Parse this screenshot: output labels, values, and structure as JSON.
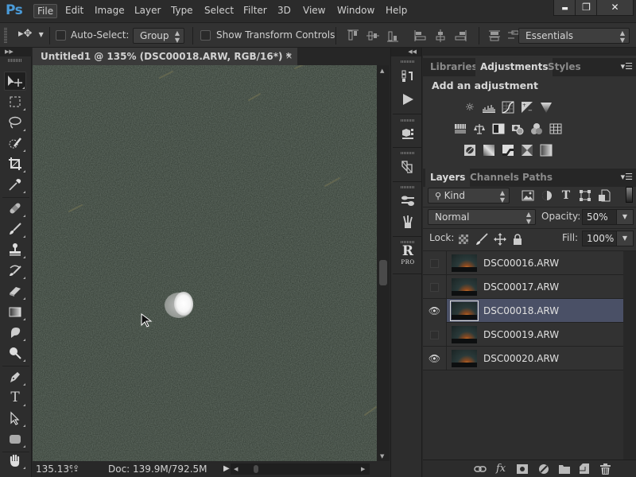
{
  "app": {
    "logo": "Ps"
  },
  "menu": [
    "File",
    "Edit",
    "Image",
    "Layer",
    "Type",
    "Select",
    "Filter",
    "3D",
    "View",
    "Window",
    "Help"
  ],
  "window_controls": {
    "minimize": "▬",
    "restore": "❐",
    "close": "✕"
  },
  "options": {
    "tool_icon": "move-tool-icon",
    "auto_select_label": "Auto-Select:",
    "auto_select_checked": false,
    "auto_select_mode": "Group",
    "show_transform_label": "Show Transform Controls",
    "show_transform_checked": false,
    "workspace": "Essentials"
  },
  "toolbar": {
    "tools": [
      {
        "name": "move-tool",
        "glyph": "▸✥",
        "active": true
      },
      {
        "name": "marquee-tool",
        "glyph": "⬚"
      },
      {
        "name": "lasso-tool",
        "glyph": "➰"
      },
      {
        "name": "quick-selection-tool",
        "glyph": "🖌"
      },
      {
        "name": "crop-tool",
        "glyph": "⌗"
      },
      {
        "name": "eyedropper-tool",
        "glyph": "🖊"
      },
      {
        "name": "healing-brush-tool",
        "glyph": "🩹"
      },
      {
        "name": "brush-tool",
        "glyph": "🖌"
      },
      {
        "name": "clone-stamp-tool",
        "glyph": "⊥"
      },
      {
        "name": "history-brush-tool",
        "glyph": "↺"
      },
      {
        "name": "eraser-tool",
        "glyph": "▰"
      },
      {
        "name": "gradient-tool",
        "glyph": "▭"
      },
      {
        "name": "blur-tool",
        "glyph": "💧"
      },
      {
        "name": "dodge-tool",
        "glyph": "⚲"
      },
      {
        "name": "pen-tool",
        "glyph": "✒"
      },
      {
        "name": "type-tool",
        "glyph": "T"
      },
      {
        "name": "path-selection-tool",
        "glyph": "↖"
      },
      {
        "name": "rectangle-tool",
        "glyph": "▢"
      },
      {
        "name": "hand-tool",
        "glyph": "✋"
      }
    ]
  },
  "document": {
    "tab_title": "Untitled1 @ 135% (DSC00018.ARW, RGB/16*) *",
    "close": "×",
    "zoom": "135.13%",
    "doc_size": "Doc: 139.9M/792.5M"
  },
  "dock": {
    "icons": [
      "history-icon",
      "actions-play-icon",
      "3d-icon",
      "clone-source-icon",
      "brush-presets-icon",
      "brushes-icon",
      "rpro-icon"
    ]
  },
  "adjustments_panel": {
    "tabs": [
      "Libraries",
      "Adjustments",
      "Styles"
    ],
    "active_tab": "Adjustments",
    "heading": "Add an adjustment",
    "rows": [
      [
        "brightness-contrast",
        "levels",
        "curves",
        "exposure",
        "vibrance"
      ],
      [
        "hue-saturation",
        "color-balance",
        "black-white",
        "photo-filter",
        "channel-mixer",
        "color-lookup"
      ],
      [
        "invert",
        "posterize",
        "threshold",
        "selective-color",
        "gradient-map"
      ]
    ]
  },
  "layers_panel": {
    "tabs": [
      "Layers",
      "Channels",
      "Paths"
    ],
    "active_tab": "Layers",
    "filter_kind": "Kind",
    "blend_mode": "Normal",
    "opacity_label": "Opacity:",
    "opacity": "50%",
    "lock_label": "Lock:",
    "fill_label": "Fill:",
    "fill": "100%",
    "layers": [
      {
        "name": "DSC00016.ARW",
        "visible": false,
        "selected": false
      },
      {
        "name": "DSC00017.ARW",
        "visible": false,
        "selected": false
      },
      {
        "name": "DSC00018.ARW",
        "visible": true,
        "selected": true
      },
      {
        "name": "DSC00019.ARW",
        "visible": false,
        "selected": false
      },
      {
        "name": "DSC00020.ARW",
        "visible": true,
        "selected": false
      }
    ],
    "footer_icons": [
      "link-layers-icon",
      "fx-icon",
      "add-mask-icon",
      "new-adjustment-icon",
      "new-group-icon",
      "new-layer-icon",
      "delete-layer-icon"
    ]
  },
  "colors": {
    "accent": "#4a9bd9",
    "selected_layer": "#4a5066",
    "canvas": "#313a32"
  }
}
